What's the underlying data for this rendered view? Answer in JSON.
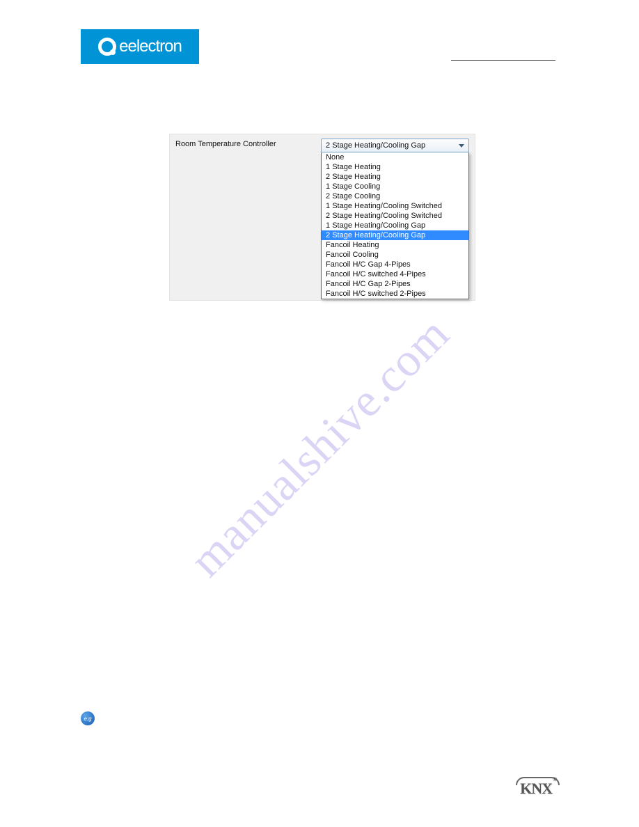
{
  "brand": {
    "name": "eelectron"
  },
  "config": {
    "row_label": "Room Temperature Controller",
    "selected_value": "2 Stage Heating/Cooling Gap",
    "options": [
      "None",
      "1 Stage Heating",
      "2 Stage Heating",
      "1 Stage Cooling",
      "2 Stage Cooling",
      "1 Stage Heating/Cooling Switched",
      "2 Stage Heating/Cooling Switched",
      "1 Stage Heating/Cooling Gap",
      "2 Stage Heating/Cooling Gap",
      "Fancoil Heating",
      "Fancoil Cooling",
      "Fancoil H/C Gap 4-Pipes",
      "Fancoil H/C switched 4-Pipes",
      "Fancoil H/C Gap 2-Pipes",
      "Fancoil H/C switched 2-Pipes"
    ],
    "highlighted_index": 8
  },
  "watermark": {
    "text": "manualshive.com"
  },
  "footer": {
    "eg_label": "e:g",
    "knx_label": "KNX"
  }
}
